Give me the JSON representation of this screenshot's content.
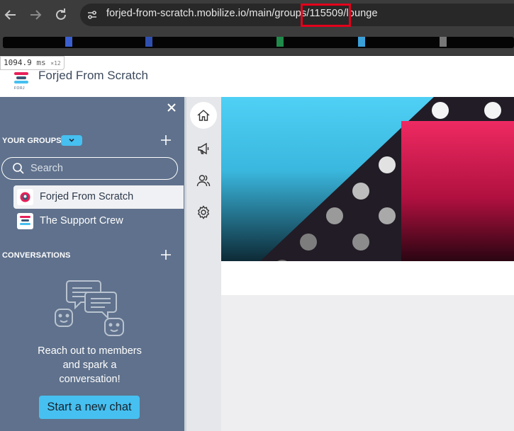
{
  "browser": {
    "url": "forjed-from-scratch.mobilize.io/main/groups/115509/lounge",
    "back_icon": "arrow-left-icon",
    "forward_icon": "arrow-right-icon",
    "reload_icon": "reload-icon",
    "site_info_icon": "tune-icon",
    "highlight_color": "#e3001b"
  },
  "perf": {
    "value": "1094.9",
    "unit": "ms",
    "multiplier": "×12"
  },
  "app": {
    "title": "Forjed From Scratch",
    "logo_text": "FORJ"
  },
  "sidebar": {
    "close_icon": "close-icon",
    "groups_label": "YOUR GROUPS",
    "search_placeholder": "Search",
    "groups": [
      {
        "label": "Forjed From Scratch",
        "active": true
      },
      {
        "label": "The Support Crew",
        "active": false
      }
    ],
    "conversations_label": "CONVERSATIONS",
    "empty_message": "Reach out to members and spark a conversation!",
    "start_chat_label": "Start a new chat"
  },
  "rail": {
    "icons": [
      "home-icon",
      "megaphone-icon",
      "members-icon",
      "gear-icon"
    ]
  },
  "colors": {
    "sidebar_bg": "#5f718c",
    "accent": "#46c0f0",
    "banner_pink": "#e8205a",
    "banner_blue": "#46c8f0"
  }
}
